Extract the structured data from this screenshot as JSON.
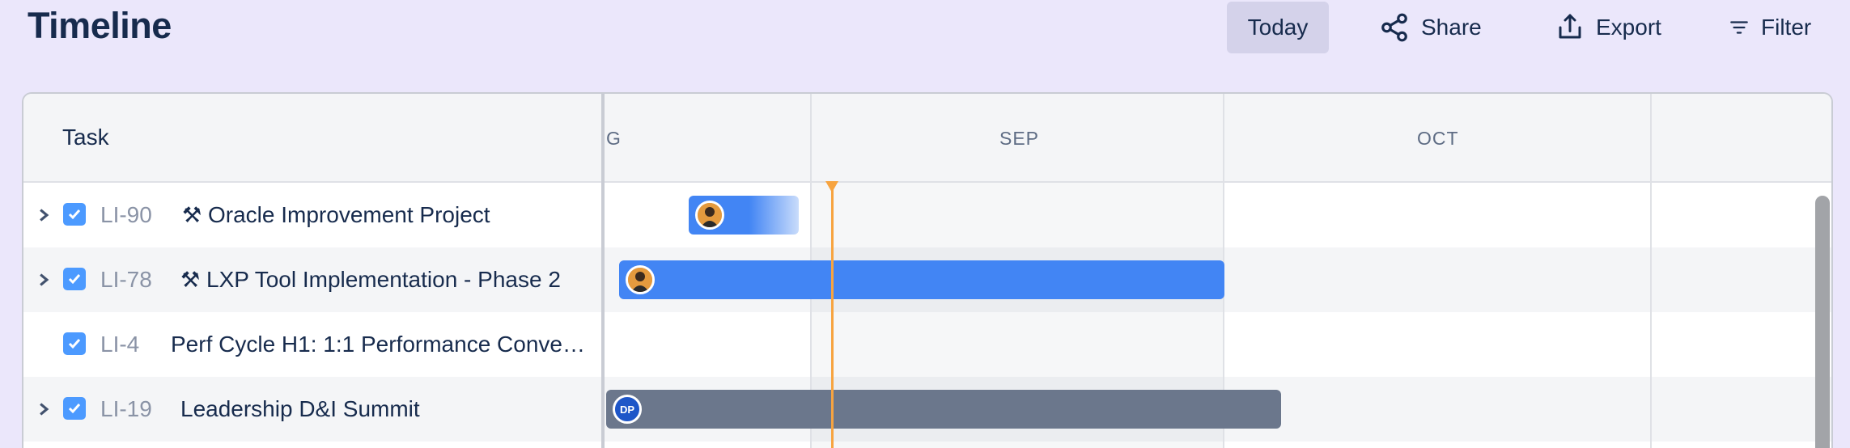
{
  "header": {
    "title": "Timeline",
    "today_label": "Today",
    "share_label": "Share",
    "export_label": "Export",
    "filter_label": "Filter"
  },
  "timeline": {
    "task_column_label": "Task",
    "months": [
      "G",
      "SEP",
      "OCT"
    ]
  },
  "rows": [
    {
      "key": "LI-90",
      "icon": "⚒",
      "summary": "Oracle Improvement Project",
      "expandable": true,
      "checked": true,
      "bar_color": "#4285f4",
      "assignee": "photo"
    },
    {
      "key": "LI-78",
      "icon": "⚒",
      "summary": "LXP Tool Implementation - Phase 2",
      "expandable": true,
      "checked": true,
      "bar_color": "#4285f4",
      "assignee": "photo"
    },
    {
      "key": "LI-4",
      "icon": "",
      "summary": "Perf Cycle H1: 1:1 Performance Conve…",
      "expandable": false,
      "checked": true,
      "bar_color": "",
      "assignee": ""
    },
    {
      "key": "LI-19",
      "icon": "",
      "summary": "Leadership D&I Summit",
      "expandable": true,
      "checked": true,
      "bar_color": "#6b778c",
      "assignee": "DP"
    }
  ],
  "colors": {
    "background": "#ebe7fb",
    "accent_blue": "#4285f4",
    "today_marker": "#f7a440",
    "gray_bar": "#6b778c"
  }
}
